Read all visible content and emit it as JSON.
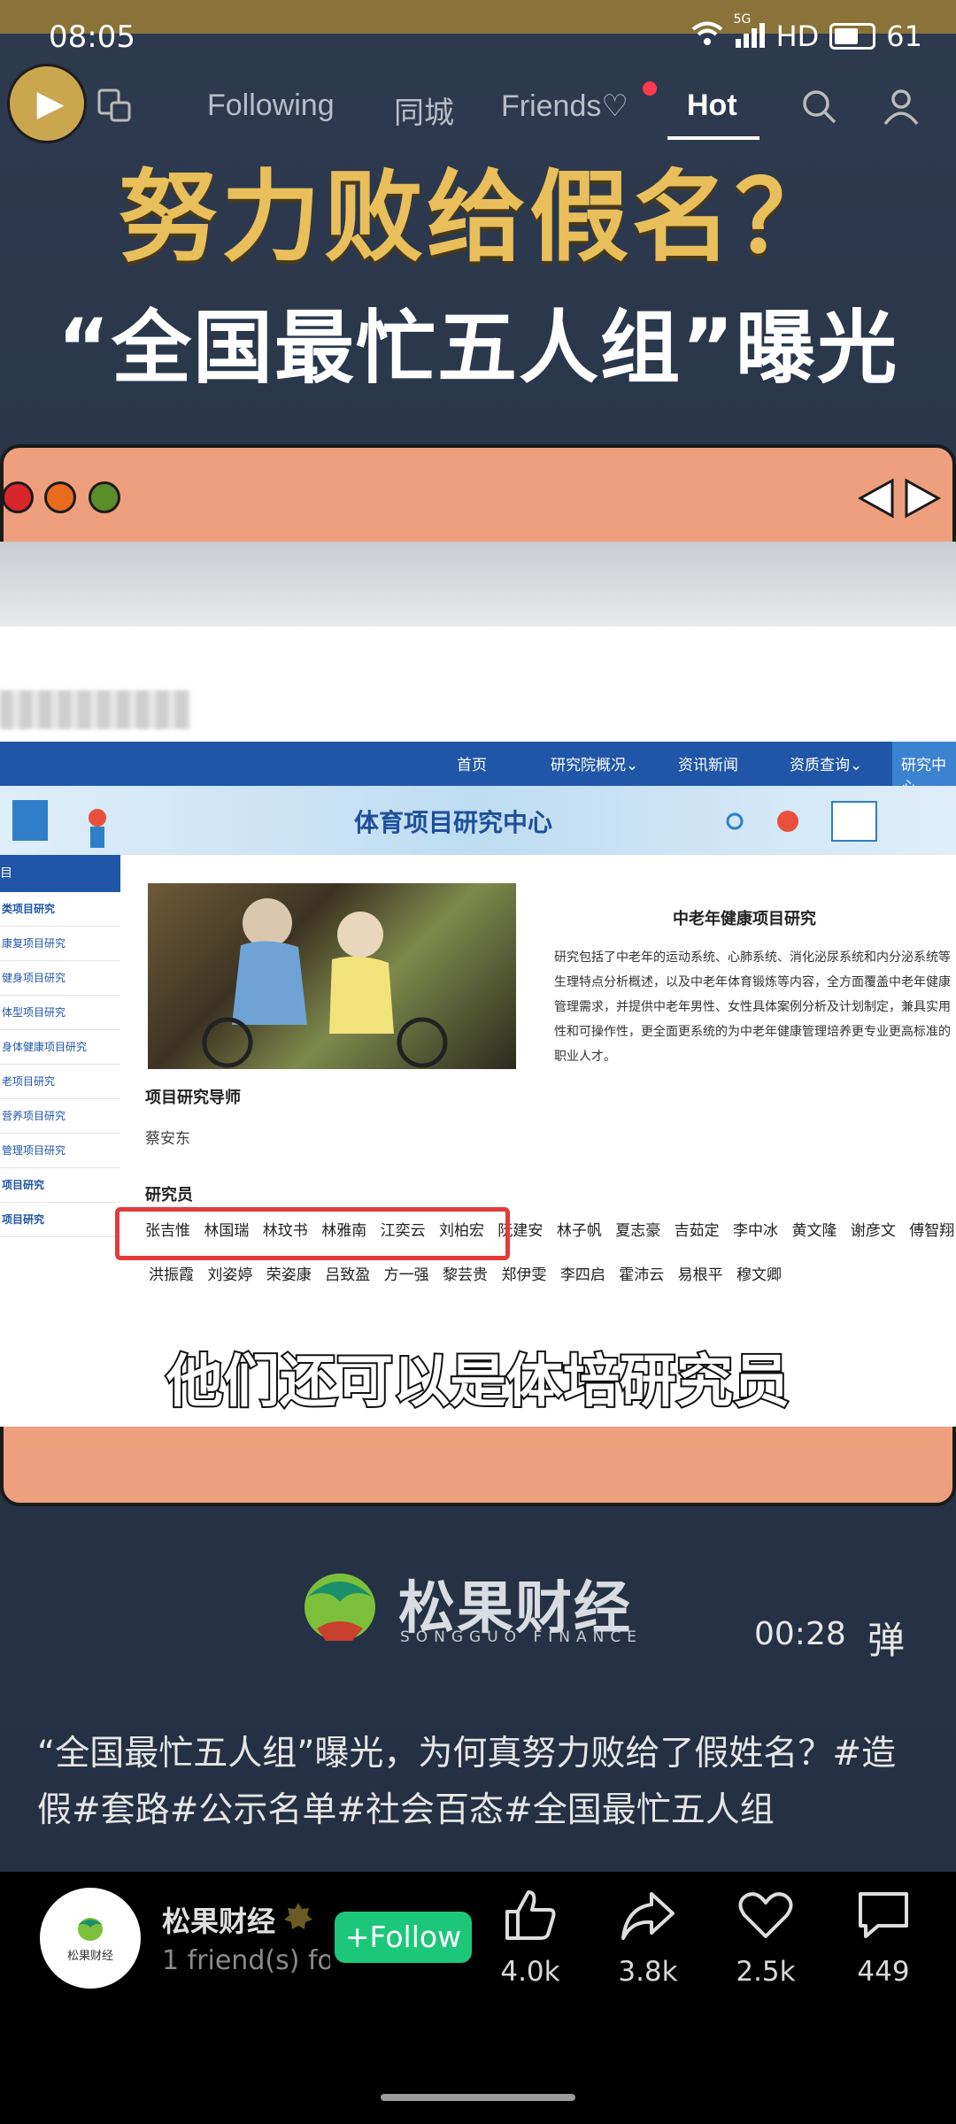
{
  "status_bar": {
    "time": "08:05",
    "network": "5G",
    "hd": "HD",
    "battery": "61"
  },
  "top_nav": {
    "tabs": [
      {
        "label": "Following"
      },
      {
        "label": "同城"
      },
      {
        "label": "Friends♡"
      },
      {
        "label": "Hot"
      }
    ]
  },
  "video": {
    "headline1": "努力败给假名？",
    "headline2": "“全国最忙五人组”曝光",
    "webpage": {
      "nav": [
        "首页",
        "研究院概况⌄",
        "资讯新闻",
        "资质查询⌄",
        "研究中心"
      ],
      "banner_title": "体育项目研究中心",
      "left_menu": [
        "目",
        "类项目研究",
        "康复项目研究",
        "健身项目研究",
        "体型项目研究",
        "身体健康项目研究",
        "老项目研究",
        "营养项目研究",
        "管理项目研究",
        "项目研究",
        "项目研究"
      ],
      "article_title": "中老年健康项目研究",
      "article_body": "研究包括了中老年的运动系统、心肺系统、消化泌尿系统和内分泌系统等生理特点分析概述，以及中老年体育锻炼等内容，全方面覆盖中老年健康管理需求，并提供中老年男性、女性具体案例分析及计划制定，兼具实用性和可操作性，更全面更系统的为中老年健康管理培养更专业更高标准的职业人才。",
      "mentor_label": "项目研究导师",
      "mentor_name": "蔡安东",
      "researchers_label": "研究员",
      "researchers_row1": "张吉惟 林国瑞 林玟书 林雅南 江奕云 刘柏宏 阮建安 林子帆 夏志豪 吉茹定 李中冰 黄文隆 谢彦文 傅智翔",
      "researchers_row2": "洪振霞 刘姿婷 荣姿康 吕致盈 方一强 黎芸贵 郑伊雯 李四启 霍沛云 易根平 穆文卿"
    },
    "subtitle": "他们还可以是体培研究员",
    "brand_name": "松果财经",
    "brand_sub": "SONGGUO FINANCE",
    "timer": "00:28",
    "danmu_label": "弹"
  },
  "caption": "“全国最忙五人组”曝光，为何真努力败给了假姓名？#造假#套路#公示名单#社会百态#全国最忙五人组",
  "author": {
    "name": "松果财经",
    "avatar_text": "松果财经",
    "subline": "1 friend(s) fo",
    "follow_label": "+Follow"
  },
  "actions": {
    "like": "4.0k",
    "share": "3.8k",
    "favorite": "2.5k",
    "comment": "449"
  },
  "colors": {
    "accent_gold": "#e9bf5b",
    "follow_green": "#1dc77a",
    "window_salmon": "#ee9f7e",
    "highlight_red": "#e23b3b"
  }
}
